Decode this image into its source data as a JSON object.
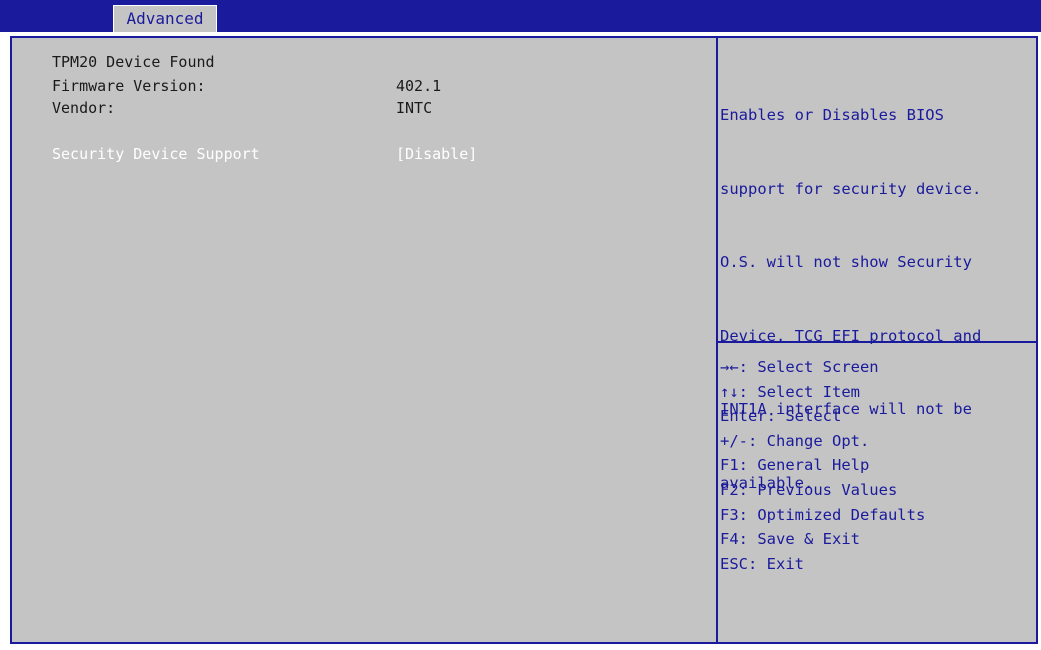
{
  "tabs": [
    {
      "label": "Advanced",
      "active": true
    }
  ],
  "settings": [
    {
      "label": "TPM20 Device Found",
      "value": ""
    },
    {
      "label": "Firmware Version:",
      "value": "402.1"
    },
    {
      "label": "Vendor:",
      "value": "INTC"
    },
    {
      "label": "Security Device Support",
      "value": "[Disable]",
      "selected": true
    }
  ],
  "help": {
    "lines": [
      "Enables or Disables BIOS",
      "support for security device.",
      "O.S. will not show Security",
      "Device. TCG EFI protocol and",
      "INT1A interface will not be",
      "available."
    ]
  },
  "key_legend": [
    "→←: Select Screen",
    "↑↓: Select Item",
    "Enter: Select",
    "+/-: Change Opt.",
    "F1: General Help",
    "F2: Previous Values",
    "F3: Optimized Defaults",
    "F4: Save & Exit",
    "ESC: Exit"
  ],
  "colors": {
    "background": "#c4c4c4",
    "accent": "#1a1a9c",
    "selected_text": "#ffffff"
  }
}
